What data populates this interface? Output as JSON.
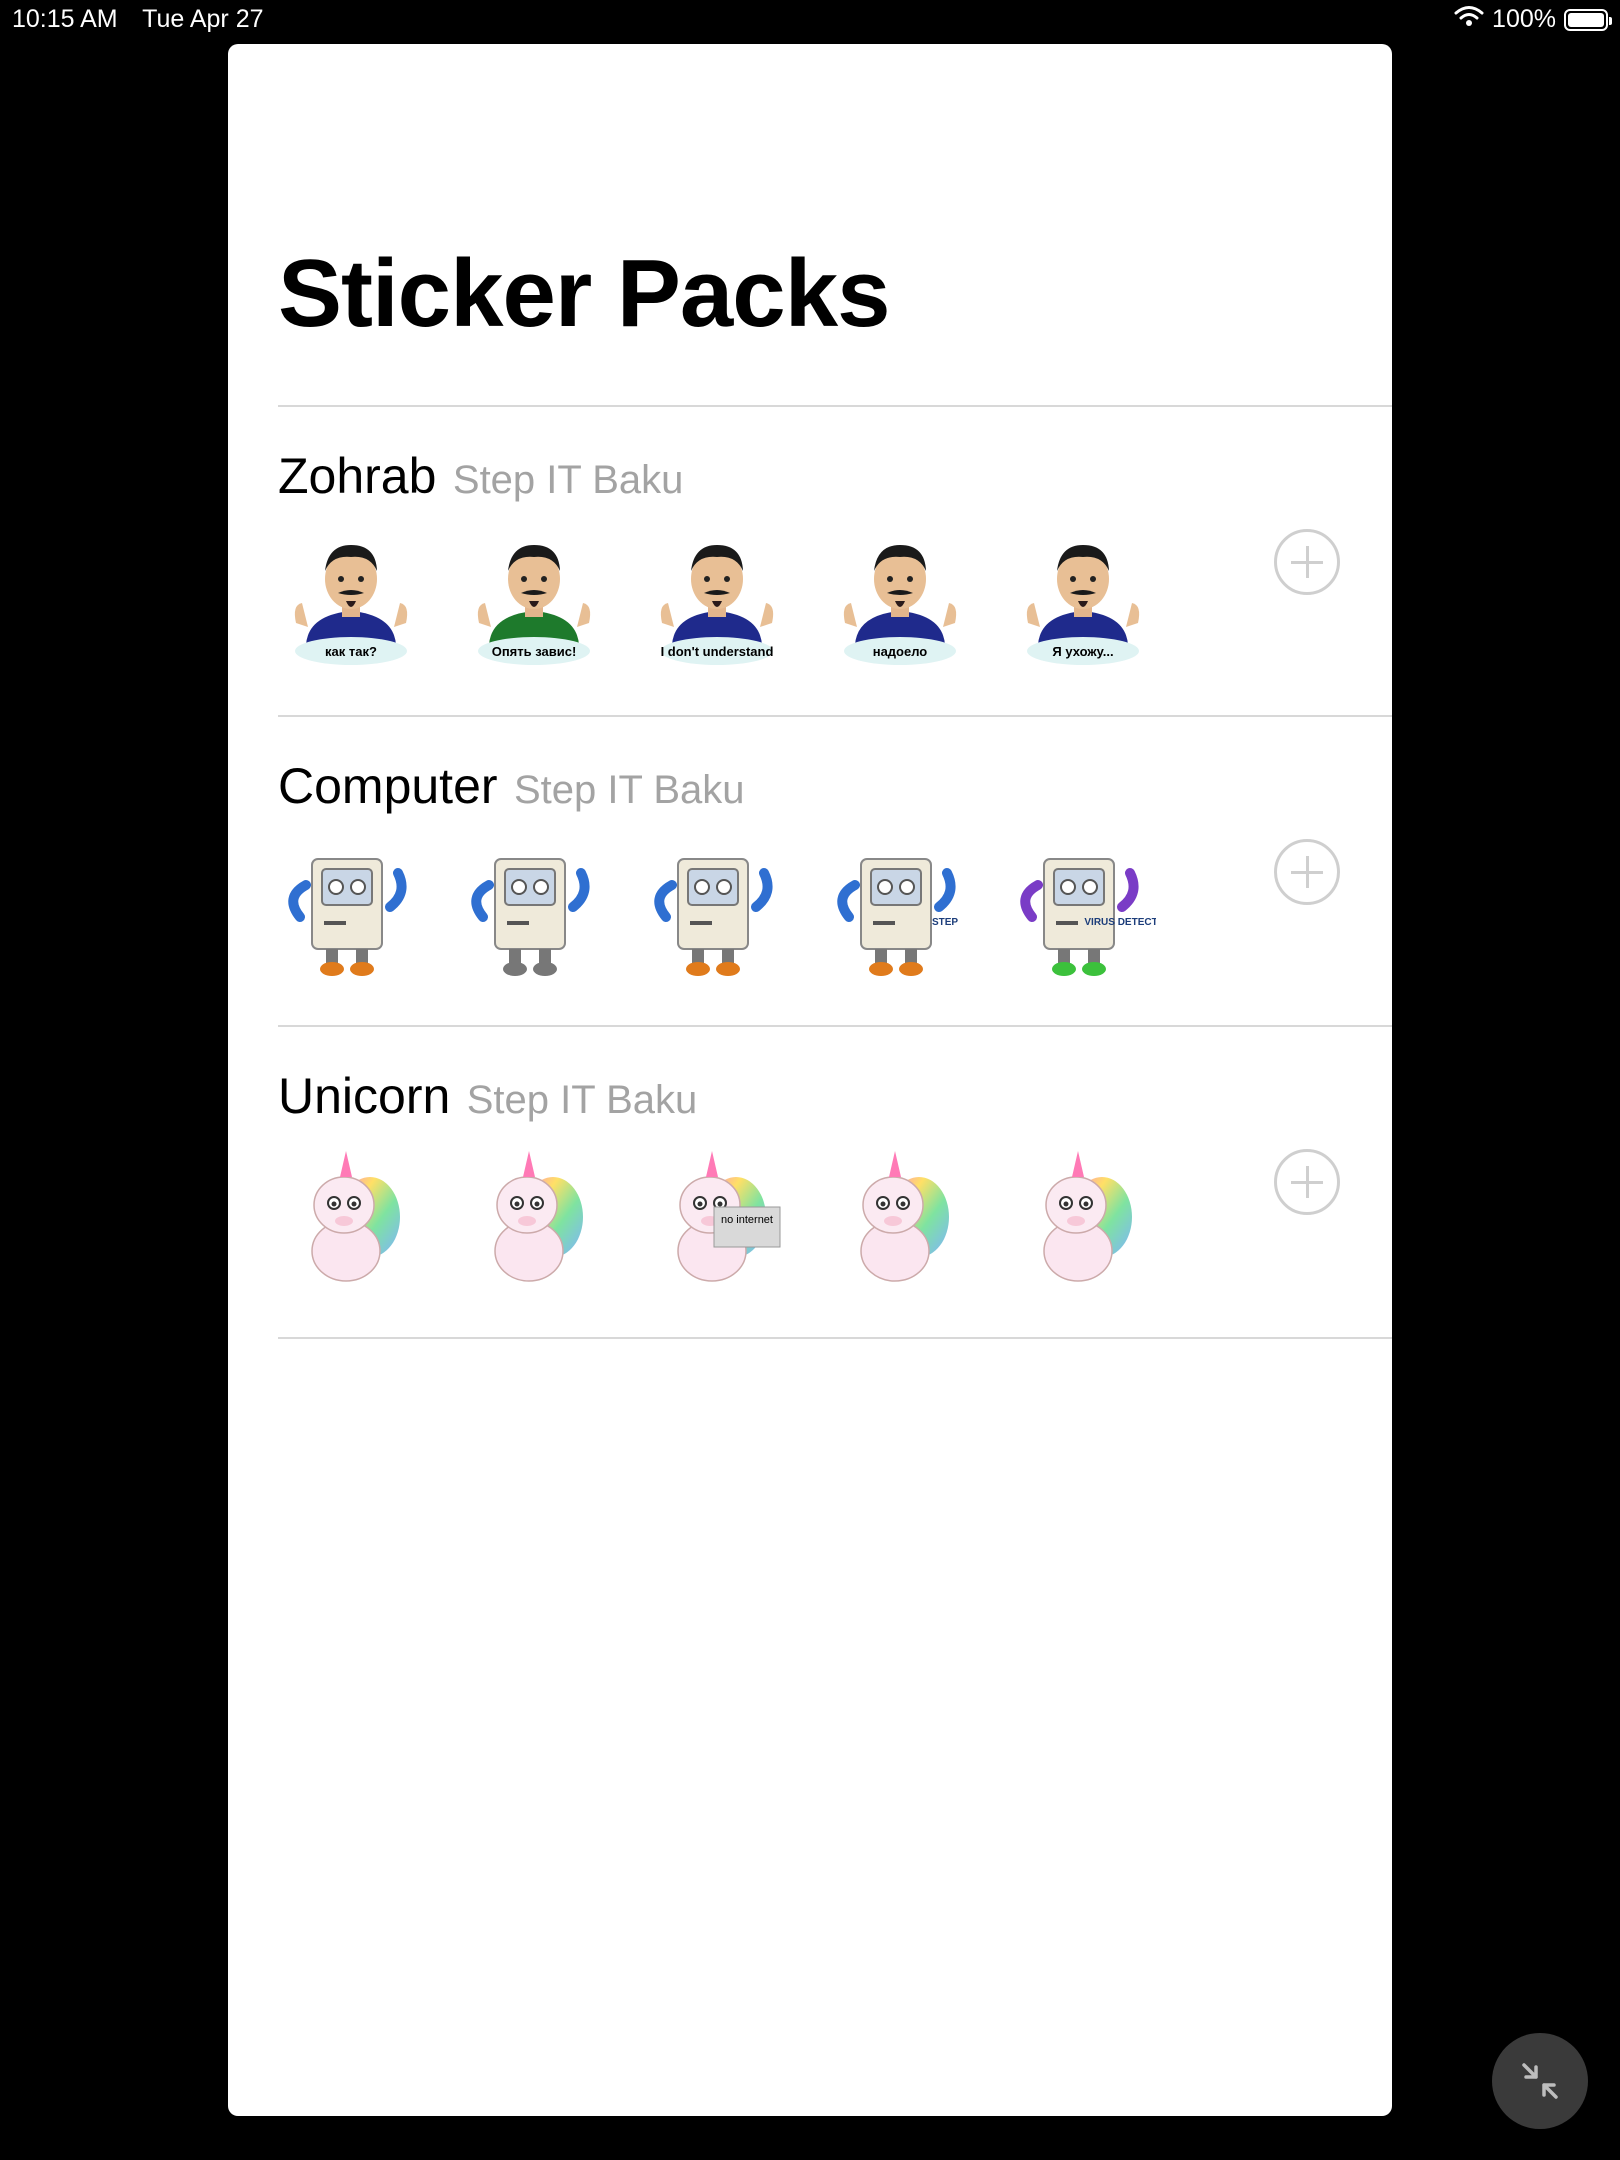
{
  "status_bar": {
    "time": "10:15 AM",
    "date": "Tue Apr 27",
    "battery": "100%"
  },
  "title": "Sticker Packs",
  "packs": [
    {
      "name": "Zohrab",
      "publisher": "Step IT Baku",
      "stickers": [
        {
          "type": "man",
          "shirt": "#1f2a8c",
          "caption": "как так?"
        },
        {
          "type": "man",
          "shirt": "#1e7a2c",
          "caption": "Опять завис!"
        },
        {
          "type": "man",
          "shirt": "#1f2a8c",
          "caption": "I don't understand"
        },
        {
          "type": "man",
          "shirt": "#1f2a8c",
          "caption": "надоело"
        },
        {
          "type": "man",
          "shirt": "#1f2a8c",
          "caption": "Я ухожу..."
        }
      ]
    },
    {
      "name": "Computer",
      "publisher": "Step IT Baku",
      "stickers": [
        {
          "type": "computer",
          "arms": "#2f6fd1",
          "feet": "#e07b1c",
          "caption": ""
        },
        {
          "type": "computer",
          "arms": "#2f6fd1",
          "feet": "#777777",
          "caption": ""
        },
        {
          "type": "computer",
          "arms": "#2f6fd1",
          "feet": "#e07b1c",
          "caption": ""
        },
        {
          "type": "computer",
          "arms": "#2f6fd1",
          "feet": "#e07b1c",
          "caption": "STEP"
        },
        {
          "type": "computer",
          "arms": "#7a3cc6",
          "feet": "#3cc13c",
          "caption": "VIRUS DETECTED"
        }
      ]
    },
    {
      "name": "Unicorn",
      "publisher": "Step IT Baku",
      "stickers": [
        {
          "type": "unicorn",
          "caption": ""
        },
        {
          "type": "unicorn",
          "caption": ""
        },
        {
          "type": "unicorn",
          "caption": "no internet"
        },
        {
          "type": "unicorn",
          "caption": ""
        },
        {
          "type": "unicorn",
          "caption": ""
        }
      ]
    }
  ],
  "colors": {
    "background": "#000000",
    "sheet": "#ffffff",
    "separator": "#d8d8d8",
    "publisher_text": "#a3a3a3",
    "add_button": "#cfcfcf"
  },
  "icons": {
    "add": "plus-circle-icon",
    "minimize": "minimize-arrows-icon",
    "wifi": "wifi-icon",
    "battery": "battery-icon"
  }
}
